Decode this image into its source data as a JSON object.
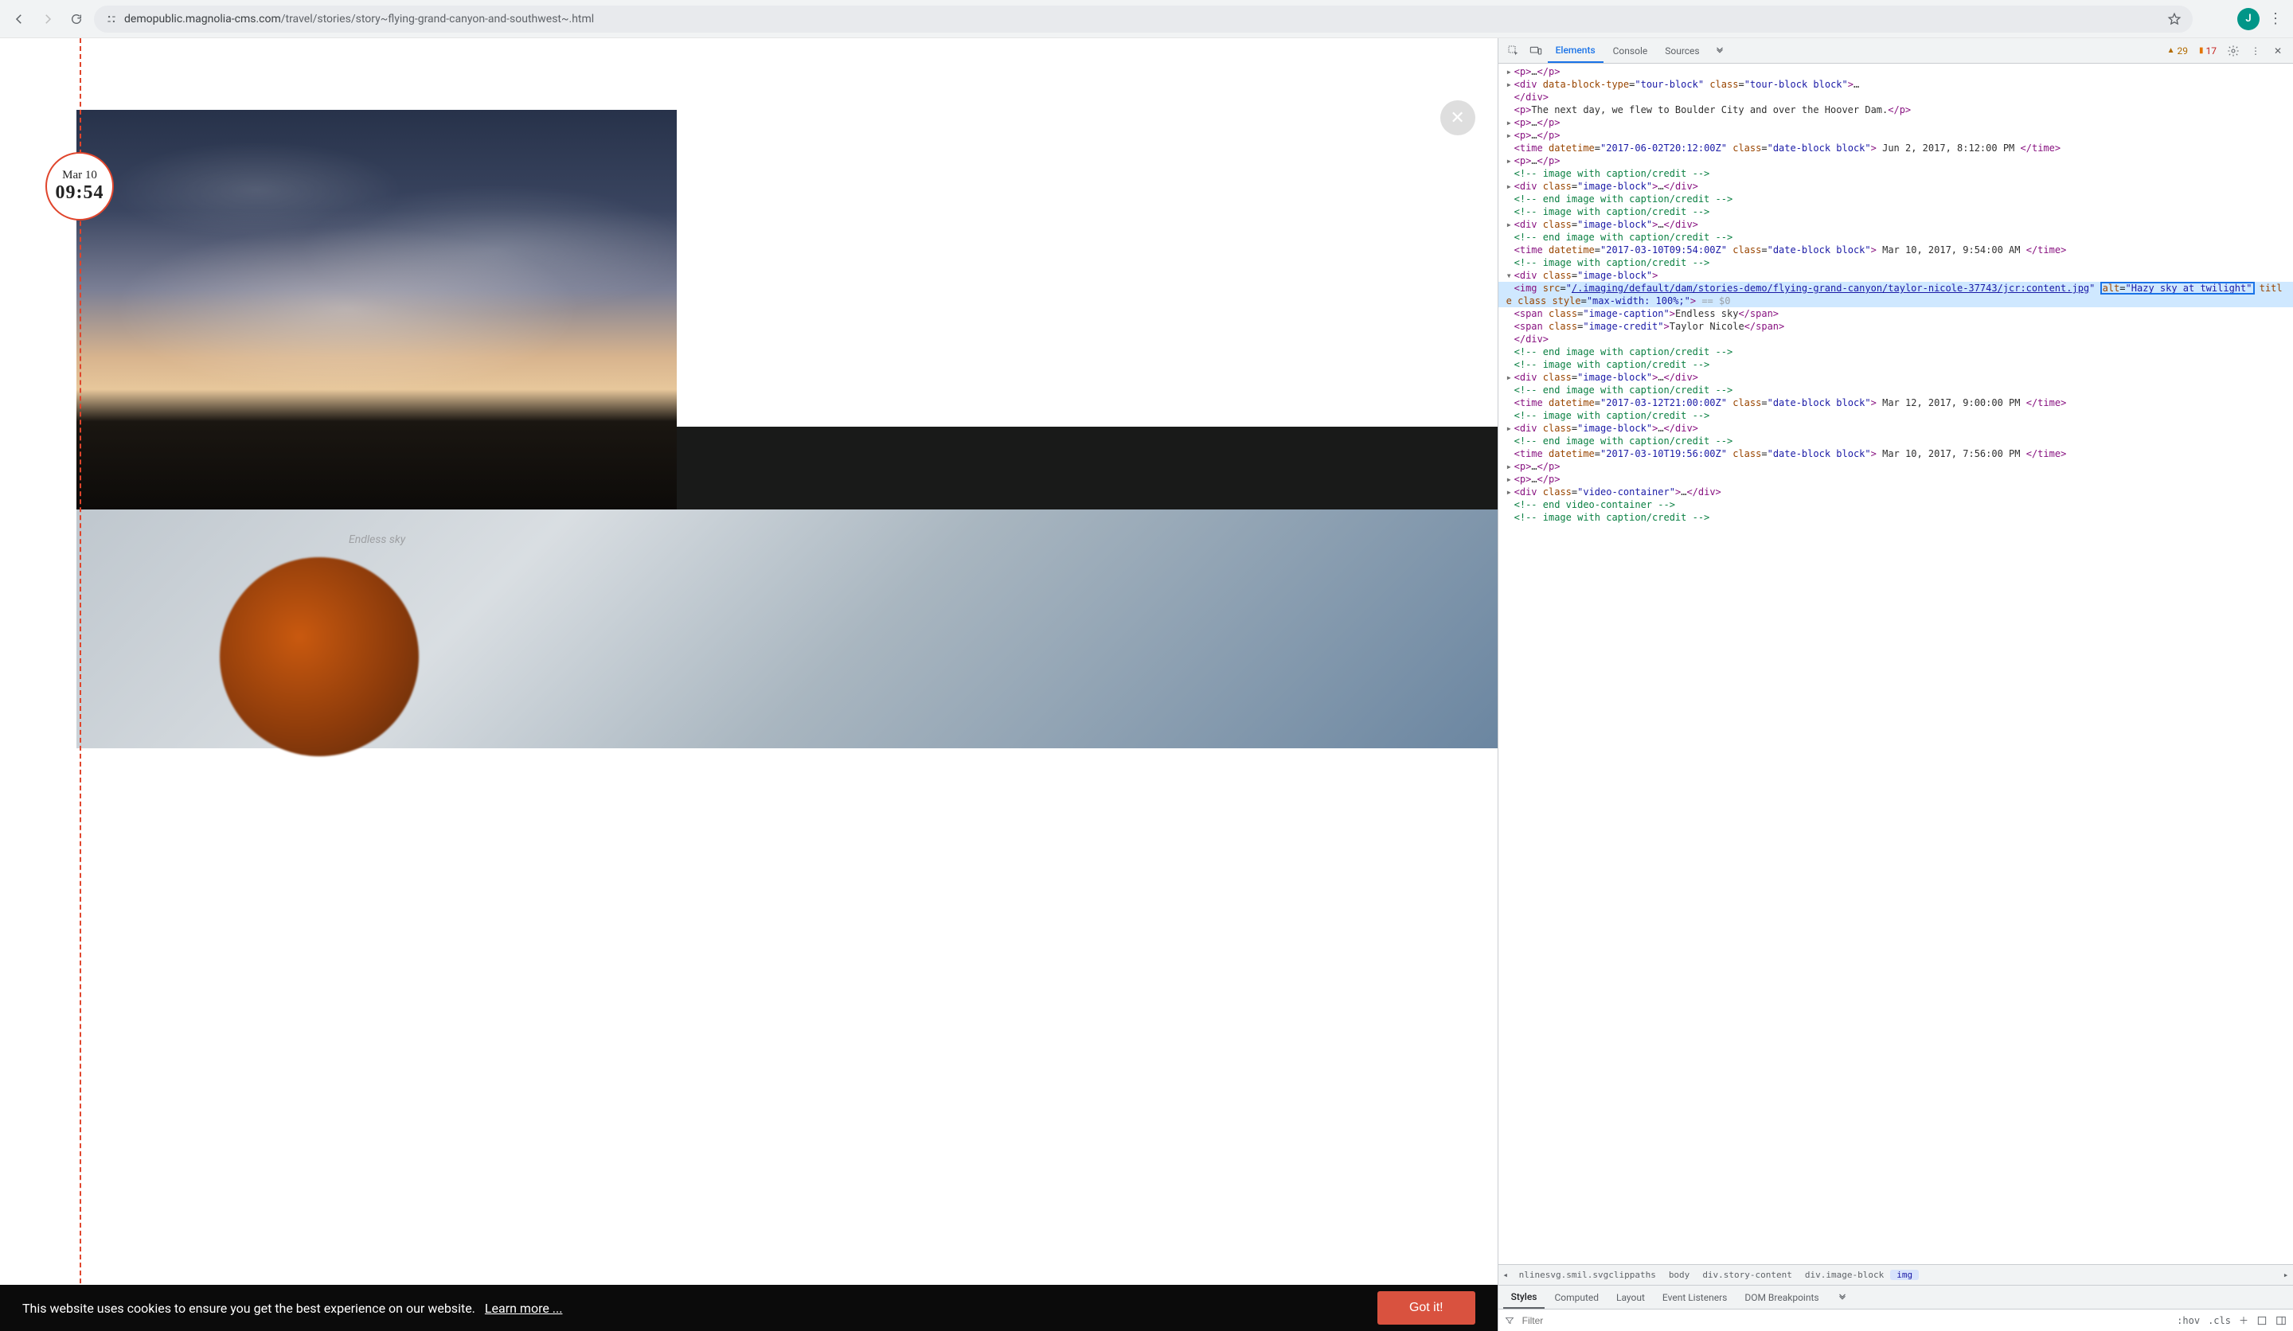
{
  "browser": {
    "url_host": "demopublic.magnolia-cms.com",
    "url_path": "/travel/stories/story~flying-grand-canyon-and-southwest~.html",
    "profile_initial": "J"
  },
  "page": {
    "date_label": "Mar 10",
    "time_label": "09:54",
    "caption": "Endless sky",
    "cookie_text": "This website uses cookies to ensure you get the best experience on our website.",
    "learn_more": "Learn more ...",
    "got_it": "Got it!"
  },
  "devtools": {
    "tabs": {
      "elements": "Elements",
      "console": "Console",
      "sources": "Sources"
    },
    "warn_count": "29",
    "err_count": "17",
    "crumbs": {
      "c1": "nlinesvg.smil.svgclippaths",
      "c2": "body",
      "c3": "div.story-content",
      "c4": "div.image-block",
      "c5": "img"
    },
    "styles_tabs": {
      "styles": "Styles",
      "computed": "Computed",
      "layout": "Layout",
      "evt": "Event Listeners",
      "dom": "DOM Breakpoints"
    },
    "filter_placeholder": "Filter",
    "hov": ":hov",
    "cls": ".cls",
    "dom": {
      "p_text1": "The next day, we flew to Boulder City and over the Hoover Dam.",
      "time1_dt": "2017-06-02T20:12:00Z",
      "time1_txt": "Jun 2, 2017, 8:12:00 PM",
      "time2_dt": "2017-03-10T09:54:00Z",
      "time2_txt": "Mar 10, 2017, 9:54:00 AM",
      "img_src": "/.imaging/default/dam/stories-demo/flying-grand-canyon/taylor-nicole-37743/jcr:content.jpg",
      "img_alt": "Hazy sky at twilight",
      "img_style": "max-width: 100%;",
      "eq0": " == $0",
      "caption_txt": "Endless sky",
      "credit_txt": "Taylor Nicole",
      "time3_dt": "2017-03-12T21:00:00Z",
      "time3_txt": "Mar 12, 2017, 9:00:00 PM",
      "time4_dt": "2017-03-10T19:56:00Z",
      "time4_txt": "Mar 10, 2017, 7:56:00 PM",
      "cmt_img": " image with caption/credit ",
      "cmt_end_img": " end image with caption/credit ",
      "cmt_end_video": " end video-container ",
      "tourblock_attr": "tour-block",
      "tourblock_cls": "tour-block block",
      "imageblock_cls": "image-block",
      "dateblock_cls": "date-block block",
      "imgcaption_cls": "image-caption",
      "imgcredit_cls": "image-credit",
      "videocont_cls": "video-container"
    }
  }
}
